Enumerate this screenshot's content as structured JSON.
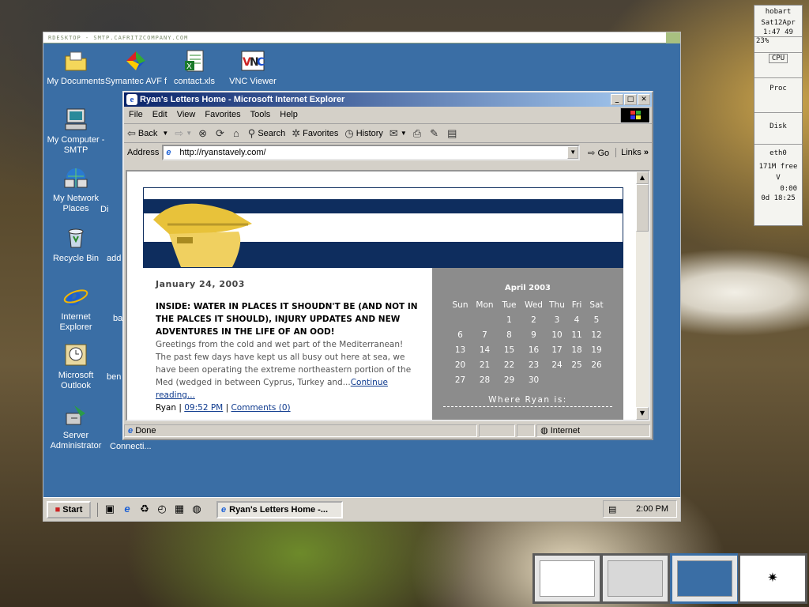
{
  "rdp": {
    "title": "RDESKTOP - SMTP.CAFRITZCOMPANY.COM"
  },
  "desktop_icons": [
    {
      "label": "My Documents",
      "icon": "folder-documents-icon"
    },
    {
      "label": "Symantec AVF for...",
      "icon": "symantec-icon"
    },
    {
      "label": "contact.xls",
      "icon": "excel-file-icon"
    },
    {
      "label": "VNC Viewer",
      "icon": "vnc-icon"
    },
    {
      "label": "My Computer - SMTP",
      "icon": "my-computer-icon"
    },
    {
      "label": "My Network Places",
      "icon": "network-places-icon"
    },
    {
      "label": "Di",
      "icon": "partial-icon"
    },
    {
      "label": "Recycle Bin",
      "icon": "recycle-bin-icon"
    },
    {
      "label": "add",
      "icon": "partial-icon"
    },
    {
      "label": "Internet Explorer",
      "icon": "ie-icon"
    },
    {
      "label": "ba",
      "icon": "partial-icon"
    },
    {
      "label": "Microsoft Outlook",
      "icon": "outlook-icon"
    },
    {
      "label": "ben",
      "icon": "partial-icon"
    },
    {
      "label": "Server Administrator",
      "icon": "server-admin-icon"
    },
    {
      "label": "Connecti...",
      "icon": "partial-icon"
    }
  ],
  "ie": {
    "title": "Ryan's Letters Home - Microsoft Internet Explorer",
    "menu": [
      "File",
      "Edit",
      "View",
      "Favorites",
      "Tools",
      "Help"
    ],
    "toolbar": {
      "back": "Back",
      "search": "Search",
      "favorites": "Favorites",
      "history": "History"
    },
    "address_label": "Address",
    "address_value": "http://ryanstavely.com/",
    "go": "Go",
    "links": "Links",
    "status": "Done",
    "zone": "Internet"
  },
  "blog": {
    "date": "January 24, 2003",
    "headline": "INSIDE: WATER IN PLACES IT SHOUDN'T BE (AND NOT IN THE PALCES IT SHOULD), INJURY UPDATES AND NEW ADVENTURES IN THE LIFE OF AN OOD!",
    "body": "Greetings from the cold and wet part of the Mediterranean! The past few days have kept us all busy out here at sea, we have been operating the extreme northeastern portion of the Med (wedged in between Cyprus, Turkey and...",
    "continue": "Continue reading...",
    "author": "Ryan",
    "time": "09:52 PM",
    "comments": "Comments (0)",
    "calendar": {
      "title": "April 2003",
      "days": [
        "Sun",
        "Mon",
        "Tue",
        "Wed",
        "Thu",
        "Fri",
        "Sat"
      ],
      "weeks": [
        [
          "",
          "",
          "1",
          "2",
          "3",
          "4",
          "5"
        ],
        [
          "6",
          "7",
          "8",
          "9",
          "10",
          "11",
          "12"
        ],
        [
          "13",
          "14",
          "15",
          "16",
          "17",
          "18",
          "19"
        ],
        [
          "20",
          "21",
          "22",
          "23",
          "24",
          "25",
          "26"
        ],
        [
          "27",
          "28",
          "29",
          "30",
          "",
          "",
          ""
        ]
      ]
    },
    "where": "Where Ryan is:"
  },
  "taskbar": {
    "start": "Start",
    "task": "Ryan's Letters Home -...",
    "clock": "2:00 PM"
  },
  "gkrellm": {
    "host": "hobart",
    "date": "Sat12Apr",
    "time": "1:47 49",
    "pct": "23%",
    "cpu": "CPU",
    "proc": "Proc",
    "disk": "Disk",
    "net": "eth0",
    "mem": "171M free",
    "vol": "V",
    "uptime1": "0:00",
    "uptime2": "0d 18:25"
  }
}
